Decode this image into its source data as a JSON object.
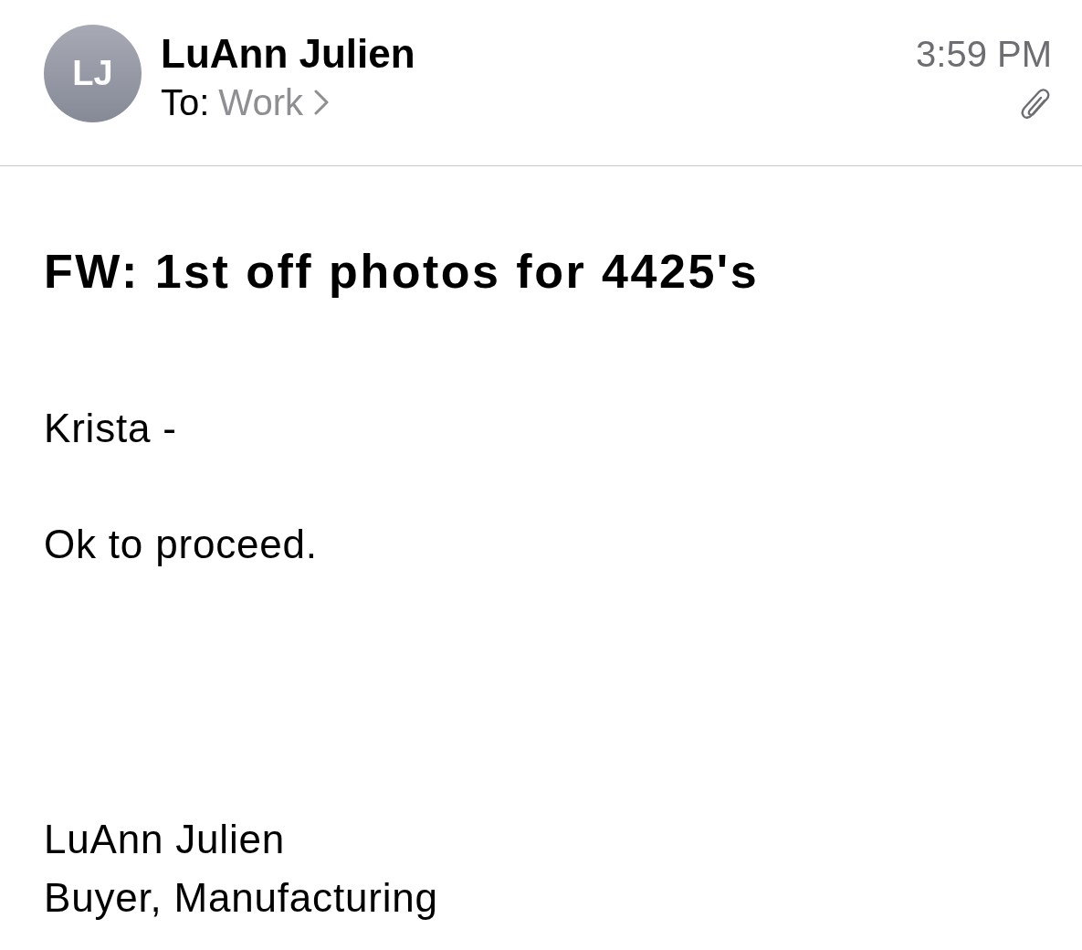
{
  "header": {
    "sender": {
      "initials": "LJ",
      "name": "LuAnn Julien"
    },
    "recipient": {
      "label": "To:",
      "value": "Work"
    },
    "time": "3:59 PM",
    "has_attachment": true
  },
  "subject": "FW: 1st off photos for 4425's",
  "body": {
    "greeting": "Krista -",
    "message": "Ok to proceed.",
    "signature": [
      "LuAnn Julien",
      "Buyer, Manufacturing"
    ]
  }
}
